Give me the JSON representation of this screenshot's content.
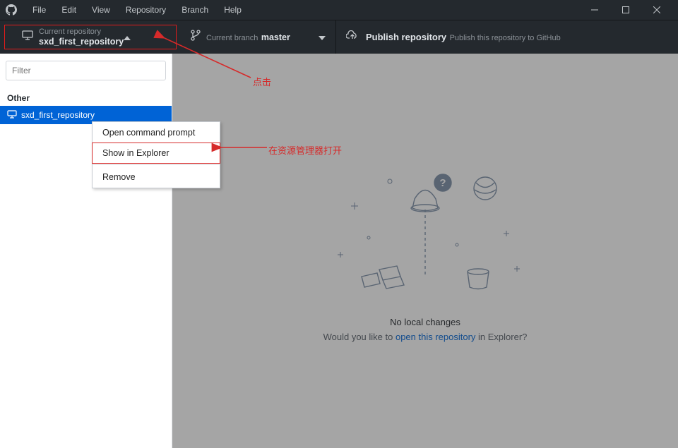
{
  "menu": {
    "file": "File",
    "edit": "Edit",
    "view": "View",
    "repository": "Repository",
    "branch": "Branch",
    "help": "Help"
  },
  "repo_dropdown": {
    "label": "Current repository",
    "value": "sxd_first_repository"
  },
  "branch_dropdown": {
    "label": "Current branch",
    "value": "master"
  },
  "publish": {
    "title": "Publish repository",
    "sub": "Publish this repository to GitHub"
  },
  "sidebar": {
    "filter_placeholder": "Filter",
    "section": "Other",
    "items": [
      {
        "name": "sxd_first_repository"
      }
    ]
  },
  "context_menu": {
    "open_cmd": "Open command prompt",
    "show_explorer": "Show in Explorer",
    "remove": "Remove"
  },
  "empty": {
    "title": "No local changes",
    "sub_prefix": "Would you like to ",
    "link": "open this repository",
    "sub_suffix": " in Explorer?"
  },
  "annotations": {
    "click": "点击",
    "open_in_explorer": "在资源管理器打开"
  }
}
